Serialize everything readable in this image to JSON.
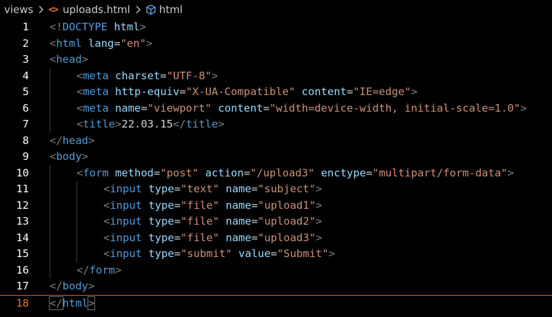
{
  "breadcrumb": {
    "folder": "views",
    "file": "uploads.html",
    "file_icon": "html-file-icon",
    "symbol": "html",
    "symbol_icon": "cube-symbol-icon"
  },
  "colors": {
    "background": "#000000",
    "tag": "#569cd6",
    "attribute": "#9cdcfe",
    "string": "#ce9178",
    "bracket": "#808080",
    "text": "#d4d4d4",
    "active_line_number": "#e37933"
  },
  "editor": {
    "current_line": 18,
    "lines": [
      {
        "n": "1",
        "indent": 0,
        "tokens": [
          [
            "bracket",
            "<!"
          ],
          [
            "tag",
            "DOCTYPE"
          ],
          [
            "text",
            " "
          ],
          [
            "attr",
            "html"
          ],
          [
            "bracket",
            ">"
          ]
        ]
      },
      {
        "n": "2",
        "indent": 0,
        "tokens": [
          [
            "bracket",
            "<"
          ],
          [
            "tag",
            "html"
          ],
          [
            "text",
            " "
          ],
          [
            "attr",
            "lang"
          ],
          [
            "text",
            "="
          ],
          [
            "str",
            "\"en\""
          ],
          [
            "bracket",
            ">"
          ]
        ]
      },
      {
        "n": "3",
        "indent": 0,
        "tokens": [
          [
            "bracket",
            "<"
          ],
          [
            "tag",
            "head"
          ],
          [
            "bracket",
            ">"
          ]
        ]
      },
      {
        "n": "4",
        "indent": 1,
        "tokens": [
          [
            "bracket",
            "<"
          ],
          [
            "tag",
            "meta"
          ],
          [
            "text",
            " "
          ],
          [
            "attr",
            "charset"
          ],
          [
            "text",
            "="
          ],
          [
            "str",
            "\"UTF-8\""
          ],
          [
            "bracket",
            ">"
          ]
        ]
      },
      {
        "n": "5",
        "indent": 1,
        "tokens": [
          [
            "bracket",
            "<"
          ],
          [
            "tag",
            "meta"
          ],
          [
            "text",
            " "
          ],
          [
            "attr",
            "http-equiv"
          ],
          [
            "text",
            "="
          ],
          [
            "str",
            "\"X-UA-Compatible\""
          ],
          [
            "text",
            " "
          ],
          [
            "attr",
            "content"
          ],
          [
            "text",
            "="
          ],
          [
            "str",
            "\"IE=edge\""
          ],
          [
            "bracket",
            ">"
          ]
        ]
      },
      {
        "n": "6",
        "indent": 1,
        "tokens": [
          [
            "bracket",
            "<"
          ],
          [
            "tag",
            "meta"
          ],
          [
            "text",
            " "
          ],
          [
            "attr",
            "name"
          ],
          [
            "text",
            "="
          ],
          [
            "str",
            "\"viewport\""
          ],
          [
            "text",
            " "
          ],
          [
            "attr",
            "content"
          ],
          [
            "text",
            "="
          ],
          [
            "str",
            "\"width=device-width, initial-scale=1.0\""
          ],
          [
            "bracket",
            ">"
          ]
        ]
      },
      {
        "n": "7",
        "indent": 1,
        "tokens": [
          [
            "bracket",
            "<"
          ],
          [
            "tag",
            "title"
          ],
          [
            "bracket",
            ">"
          ],
          [
            "text",
            "22.03.15"
          ],
          [
            "bracket",
            "</"
          ],
          [
            "tag",
            "title"
          ],
          [
            "bracket",
            ">"
          ]
        ]
      },
      {
        "n": "8",
        "indent": 0,
        "tokens": [
          [
            "bracket",
            "</"
          ],
          [
            "tag",
            "head"
          ],
          [
            "bracket",
            ">"
          ]
        ]
      },
      {
        "n": "9",
        "indent": 0,
        "tokens": [
          [
            "bracket",
            "<"
          ],
          [
            "tag",
            "body"
          ],
          [
            "bracket",
            ">"
          ]
        ]
      },
      {
        "n": "10",
        "indent": 1,
        "tokens": [
          [
            "bracket",
            "<"
          ],
          [
            "tag",
            "form"
          ],
          [
            "text",
            " "
          ],
          [
            "attr",
            "method"
          ],
          [
            "text",
            "="
          ],
          [
            "str",
            "\"post\""
          ],
          [
            "text",
            " "
          ],
          [
            "attr",
            "action"
          ],
          [
            "text",
            "="
          ],
          [
            "str",
            "\"/upload3\""
          ],
          [
            "text",
            " "
          ],
          [
            "attr",
            "enctype"
          ],
          [
            "text",
            "="
          ],
          [
            "str",
            "\"multipart/form-data\""
          ],
          [
            "bracket",
            ">"
          ]
        ]
      },
      {
        "n": "11",
        "indent": 2,
        "tokens": [
          [
            "bracket",
            "<"
          ],
          [
            "tag",
            "input"
          ],
          [
            "text",
            " "
          ],
          [
            "attr",
            "type"
          ],
          [
            "text",
            "="
          ],
          [
            "str",
            "\"text\""
          ],
          [
            "text",
            " "
          ],
          [
            "attr",
            "name"
          ],
          [
            "text",
            "="
          ],
          [
            "str",
            "\"subject\""
          ],
          [
            "bracket",
            ">"
          ]
        ]
      },
      {
        "n": "12",
        "indent": 2,
        "tokens": [
          [
            "bracket",
            "<"
          ],
          [
            "tag",
            "input"
          ],
          [
            "text",
            " "
          ],
          [
            "attr",
            "type"
          ],
          [
            "text",
            "="
          ],
          [
            "str",
            "\"file\""
          ],
          [
            "text",
            " "
          ],
          [
            "attr",
            "name"
          ],
          [
            "text",
            "="
          ],
          [
            "str",
            "\"upload1\""
          ],
          [
            "bracket",
            ">"
          ]
        ]
      },
      {
        "n": "13",
        "indent": 2,
        "tokens": [
          [
            "bracket",
            "<"
          ],
          [
            "tag",
            "input"
          ],
          [
            "text",
            " "
          ],
          [
            "attr",
            "type"
          ],
          [
            "text",
            "="
          ],
          [
            "str",
            "\"file\""
          ],
          [
            "text",
            " "
          ],
          [
            "attr",
            "name"
          ],
          [
            "text",
            "="
          ],
          [
            "str",
            "\"upload2\""
          ],
          [
            "bracket",
            ">"
          ]
        ]
      },
      {
        "n": "14",
        "indent": 2,
        "tokens": [
          [
            "bracket",
            "<"
          ],
          [
            "tag",
            "input"
          ],
          [
            "text",
            " "
          ],
          [
            "attr",
            "type"
          ],
          [
            "text",
            "="
          ],
          [
            "str",
            "\"file\""
          ],
          [
            "text",
            " "
          ],
          [
            "attr",
            "name"
          ],
          [
            "text",
            "="
          ],
          [
            "str",
            "\"upload3\""
          ],
          [
            "bracket",
            ">"
          ]
        ]
      },
      {
        "n": "15",
        "indent": 2,
        "tokens": [
          [
            "bracket",
            "<"
          ],
          [
            "tag",
            "input"
          ],
          [
            "text",
            " "
          ],
          [
            "attr",
            "type"
          ],
          [
            "text",
            "="
          ],
          [
            "str",
            "\"submit\""
          ],
          [
            "text",
            " "
          ],
          [
            "attr",
            "value"
          ],
          [
            "text",
            "="
          ],
          [
            "str",
            "\"Submit\""
          ],
          [
            "bracket",
            ">"
          ]
        ]
      },
      {
        "n": "16",
        "indent": 1,
        "tokens": [
          [
            "bracket",
            "</"
          ],
          [
            "tag",
            "form"
          ],
          [
            "bracket",
            ">"
          ]
        ]
      },
      {
        "n": "17",
        "indent": 0,
        "tokens": [
          [
            "bracket",
            "</"
          ],
          [
            "tag",
            "body"
          ],
          [
            "bracket",
            ">"
          ]
        ]
      },
      {
        "n": "18",
        "indent": 0,
        "tokens": [
          [
            "bracket",
            "</"
          ],
          [
            "tag",
            "html"
          ],
          [
            "bracket",
            ">"
          ]
        ]
      }
    ]
  }
}
